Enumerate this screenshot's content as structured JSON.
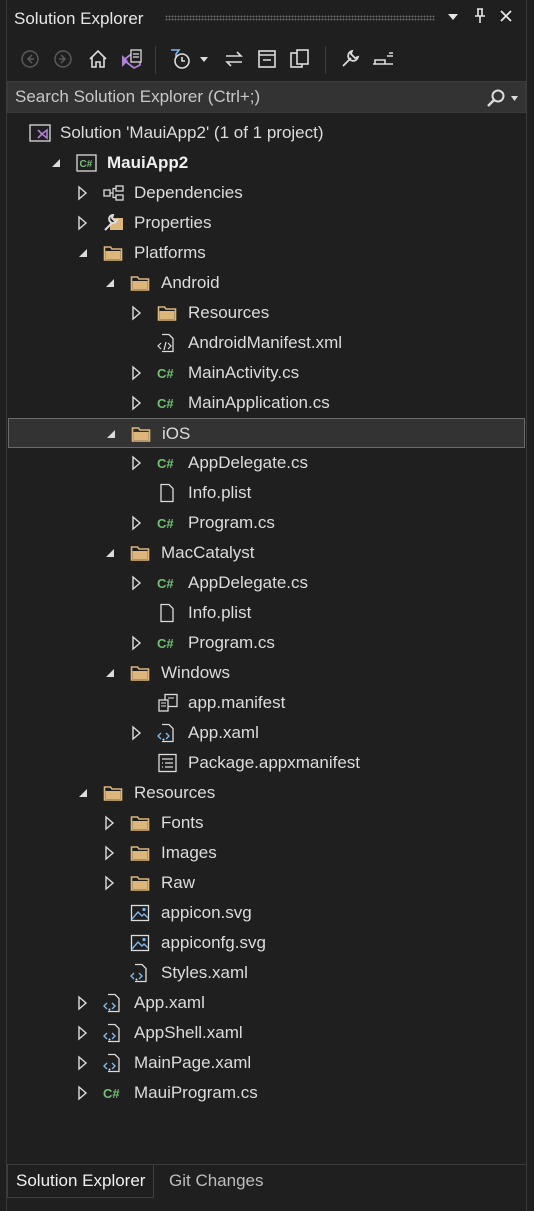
{
  "window": {
    "title": "Solution Explorer",
    "colors": {
      "accent": "#b180d7",
      "csharp": "#72c175",
      "folder": "#dcb67a",
      "background": "#1f1f1f"
    }
  },
  "titlebar_icons": [
    "dropdown-icon",
    "pin-icon",
    "close-icon"
  ],
  "toolbar": {
    "icons": [
      "back-icon",
      "forward-icon",
      "home-icon",
      "switch-views-icon",
      "pending-changes-filter-icon",
      "filter-dropdown-icon",
      "sync-icon",
      "collapse-all-icon",
      "show-all-files-icon",
      "properties-wrench-icon",
      "preview-icon"
    ]
  },
  "search": {
    "placeholder": "Search Solution Explorer (Ctrl+;)"
  },
  "tree": [
    {
      "label": "Solution 'MauiApp2' (1 of 1 project)",
      "icon": "solution-icon",
      "depth": 0,
      "arrow": "none"
    },
    {
      "label": "MauiApp2",
      "icon": "csharp-project-icon",
      "depth": 0,
      "arrow": "expanded",
      "bold": true
    },
    {
      "label": "Dependencies",
      "icon": "dependencies-icon",
      "depth": 1,
      "arrow": "collapsed"
    },
    {
      "label": "Properties",
      "icon": "properties-icon",
      "depth": 1,
      "arrow": "collapsed"
    },
    {
      "label": "Platforms",
      "icon": "folder-icon",
      "depth": 1,
      "arrow": "expanded"
    },
    {
      "label": "Android",
      "icon": "folder-icon",
      "depth": 2,
      "arrow": "expanded"
    },
    {
      "label": "Resources",
      "icon": "folder-icon",
      "depth": 3,
      "arrow": "collapsed"
    },
    {
      "label": "AndroidManifest.xml",
      "icon": "xml-file-icon",
      "depth": 3,
      "arrow": "none"
    },
    {
      "label": "MainActivity.cs",
      "icon": "csharp-file-icon",
      "depth": 3,
      "arrow": "collapsed"
    },
    {
      "label": "MainApplication.cs",
      "icon": "csharp-file-icon",
      "depth": 3,
      "arrow": "collapsed"
    },
    {
      "label": "iOS",
      "icon": "folder-icon",
      "depth": 2,
      "arrow": "expanded",
      "selected": true
    },
    {
      "label": "AppDelegate.cs",
      "icon": "csharp-file-icon",
      "depth": 3,
      "arrow": "collapsed"
    },
    {
      "label": "Info.plist",
      "icon": "file-icon",
      "depth": 3,
      "arrow": "none"
    },
    {
      "label": "Program.cs",
      "icon": "csharp-file-icon",
      "depth": 3,
      "arrow": "collapsed"
    },
    {
      "label": "MacCatalyst",
      "icon": "folder-icon",
      "depth": 2,
      "arrow": "expanded"
    },
    {
      "label": "AppDelegate.cs",
      "icon": "csharp-file-icon",
      "depth": 3,
      "arrow": "collapsed"
    },
    {
      "label": "Info.plist",
      "icon": "file-icon",
      "depth": 3,
      "arrow": "none"
    },
    {
      "label": "Program.cs",
      "icon": "csharp-file-icon",
      "depth": 3,
      "arrow": "collapsed"
    },
    {
      "label": "Windows",
      "icon": "folder-icon",
      "depth": 2,
      "arrow": "expanded"
    },
    {
      "label": "app.manifest",
      "icon": "manifest-icon",
      "depth": 3,
      "arrow": "none"
    },
    {
      "label": "App.xaml",
      "icon": "xaml-file-icon",
      "depth": 3,
      "arrow": "collapsed"
    },
    {
      "label": "Package.appxmanifest",
      "icon": "appxmanifest-icon",
      "depth": 3,
      "arrow": "none"
    },
    {
      "label": "Resources",
      "icon": "folder-icon",
      "depth": 1,
      "arrow": "expanded"
    },
    {
      "label": "Fonts",
      "icon": "folder-icon",
      "depth": 2,
      "arrow": "collapsed"
    },
    {
      "label": "Images",
      "icon": "folder-icon",
      "depth": 2,
      "arrow": "collapsed"
    },
    {
      "label": "Raw",
      "icon": "folder-icon",
      "depth": 2,
      "arrow": "collapsed"
    },
    {
      "label": "appicon.svg",
      "icon": "image-file-icon",
      "depth": 2,
      "arrow": "none"
    },
    {
      "label": "appiconfg.svg",
      "icon": "image-file-icon",
      "depth": 2,
      "arrow": "none"
    },
    {
      "label": "Styles.xaml",
      "icon": "xaml-file-icon",
      "depth": 2,
      "arrow": "none"
    },
    {
      "label": "App.xaml",
      "icon": "xaml-file-icon",
      "depth": 1,
      "arrow": "collapsed"
    },
    {
      "label": "AppShell.xaml",
      "icon": "xaml-file-icon",
      "depth": 1,
      "arrow": "collapsed"
    },
    {
      "label": "MainPage.xaml",
      "icon": "xaml-file-icon",
      "depth": 1,
      "arrow": "collapsed"
    },
    {
      "label": "MauiProgram.cs",
      "icon": "csharp-file-icon",
      "depth": 1,
      "arrow": "collapsed"
    }
  ],
  "bottom_tabs": [
    {
      "label": "Solution Explorer",
      "active": true
    },
    {
      "label": "Git Changes",
      "active": false
    }
  ]
}
